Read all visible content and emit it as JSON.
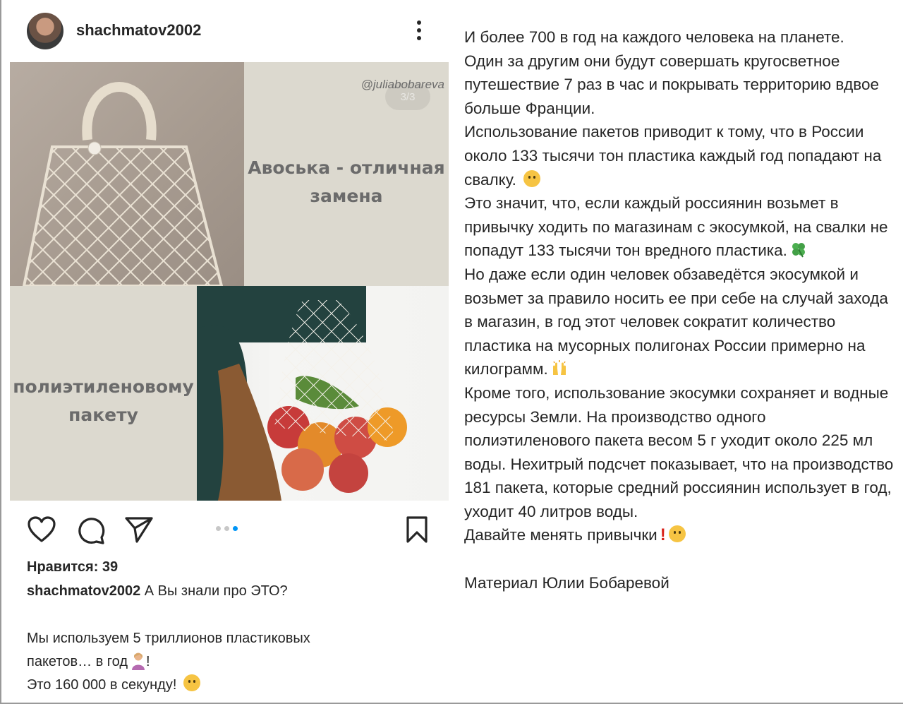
{
  "post": {
    "username": "shachmatov2002",
    "watermark": "@juliabobareva",
    "slide_counter": "3/3",
    "panel_top_text": "Авоська - отличная замена",
    "panel_bottom_text": "полиэтиленовому пакету",
    "carousel": {
      "total": 3,
      "active_index": 2
    },
    "likes": "Нравится: 39",
    "caption_username": "shachmatov2002",
    "caption_first": "А Вы знали про ЭТО?",
    "caption_lines": [
      "Мы используем 5 триллионов пластиковых",
      "пакетов… в год",
      "!",
      "Это 160 000 в секунду!"
    ]
  },
  "continuation": {
    "p1": "И более 700 в год на каждого человека на планете.",
    "p2": "Один за другим они будут совершать кругосветное путешествие 7 раз в час и покрывать территорию вдвое больше Франции.",
    "p3": "Использование пакетов приводит к тому, что в России около 133 тысячи тон пластика каждый год попадают на свалку.",
    "p4": "Это значит, что, если каждый россиянин возьмет в привычку ходить по магазинам с экосумкой, на свалки не попадут 133 тысячи тон вредного пластика.",
    "p5": "Но даже если один человек обзаведётся экосумкой и возьмет за правило носить ее при себе на случай захода в магазин, в год этот человек сократит количество пластика на мусорных полигонах России примерно на килограмм.",
    "p6": "Кроме того, использование экосумки сохраняет и водные ресурсы Земли. На производство одного полиэтиленового пакета весом 5 г уходит около 225 мл воды. Нехитрый подсчет показывает, что на производство 181 пакета, которые средний россиянин использует в год, уходит 40 литров воды.",
    "p7": "Давайте менять привычки",
    "p8": "Материал Юлии Бобаревой"
  },
  "icons": {
    "like": "heart-icon",
    "comment": "comment-icon",
    "share": "send-icon",
    "save": "bookmark-icon",
    "more": "more-vertical-icon"
  },
  "colors": {
    "text": "#262626",
    "accent_dot": "#0095f6",
    "panel_bg": "#dcd9cf",
    "panel_text": "#6b6b6b"
  }
}
